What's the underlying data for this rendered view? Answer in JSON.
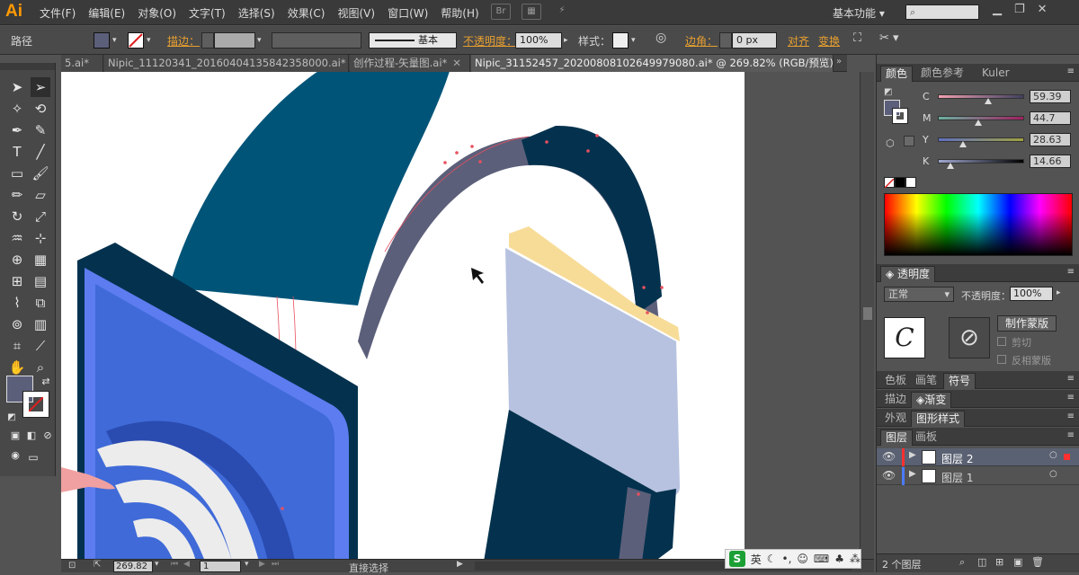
{
  "app": {
    "logo": "Ai",
    "workspace": "基本功能",
    "search_icon": "search-icon"
  },
  "menu": [
    "文件(F)",
    "编辑(E)",
    "对象(O)",
    "文字(T)",
    "选择(S)",
    "效果(C)",
    "视图(V)",
    "窗口(W)",
    "帮助(H)"
  ],
  "control": {
    "object_type": "路径",
    "stroke_label": "描边：",
    "stroke_style": "基本",
    "opacity_label": "不透明度：",
    "opacity": "100%",
    "style_label": "样式：",
    "corner_label": "边角：",
    "corner": "0 px",
    "align": "对齐",
    "transform": "变换",
    "fill_color": "#5c5f7a"
  },
  "tabs": [
    {
      "label": "5.ai*"
    },
    {
      "label": "Nipic_11120341_20160404135842358000.ai*"
    },
    {
      "label": "创作过程-矢量图.ai*"
    },
    {
      "label": "Nipic_31152457_20200808102649979080.ai* @ 269.82% (RGB/预览)"
    }
  ],
  "color_panel": {
    "tabs": [
      "颜色",
      "颜色参考",
      "Kuler"
    ],
    "channels": [
      {
        "name": "C",
        "value": "59.39"
      },
      {
        "name": "M",
        "value": "44.7"
      },
      {
        "name": "Y",
        "value": "28.63"
      },
      {
        "name": "K",
        "value": "14.66"
      }
    ]
  },
  "transparency_panel": {
    "title": "透明度",
    "mode": "正常",
    "opacity_label": "不透明度：",
    "opacity": "100%",
    "make_mask": "制作蒙版",
    "clip": "剪切",
    "invert_mask": "反相蒙版"
  },
  "swatch_tabs": [
    "色板",
    "画笔",
    "符号"
  ],
  "stroke_tabs": [
    "描边",
    "渐变"
  ],
  "appearance_tabs": [
    "外观",
    "图形样式"
  ],
  "layers_tabs": [
    "图层",
    "画板"
  ],
  "layers": [
    {
      "name": "图层 2",
      "color": "#ff3030"
    },
    {
      "name": "图层 1",
      "color": "#4a7cff"
    }
  ],
  "layers_count": "2 个图层",
  "status": {
    "zoom": "269.82",
    "page": "1",
    "tool": "直接选择"
  },
  "ime": {
    "label": "英"
  }
}
